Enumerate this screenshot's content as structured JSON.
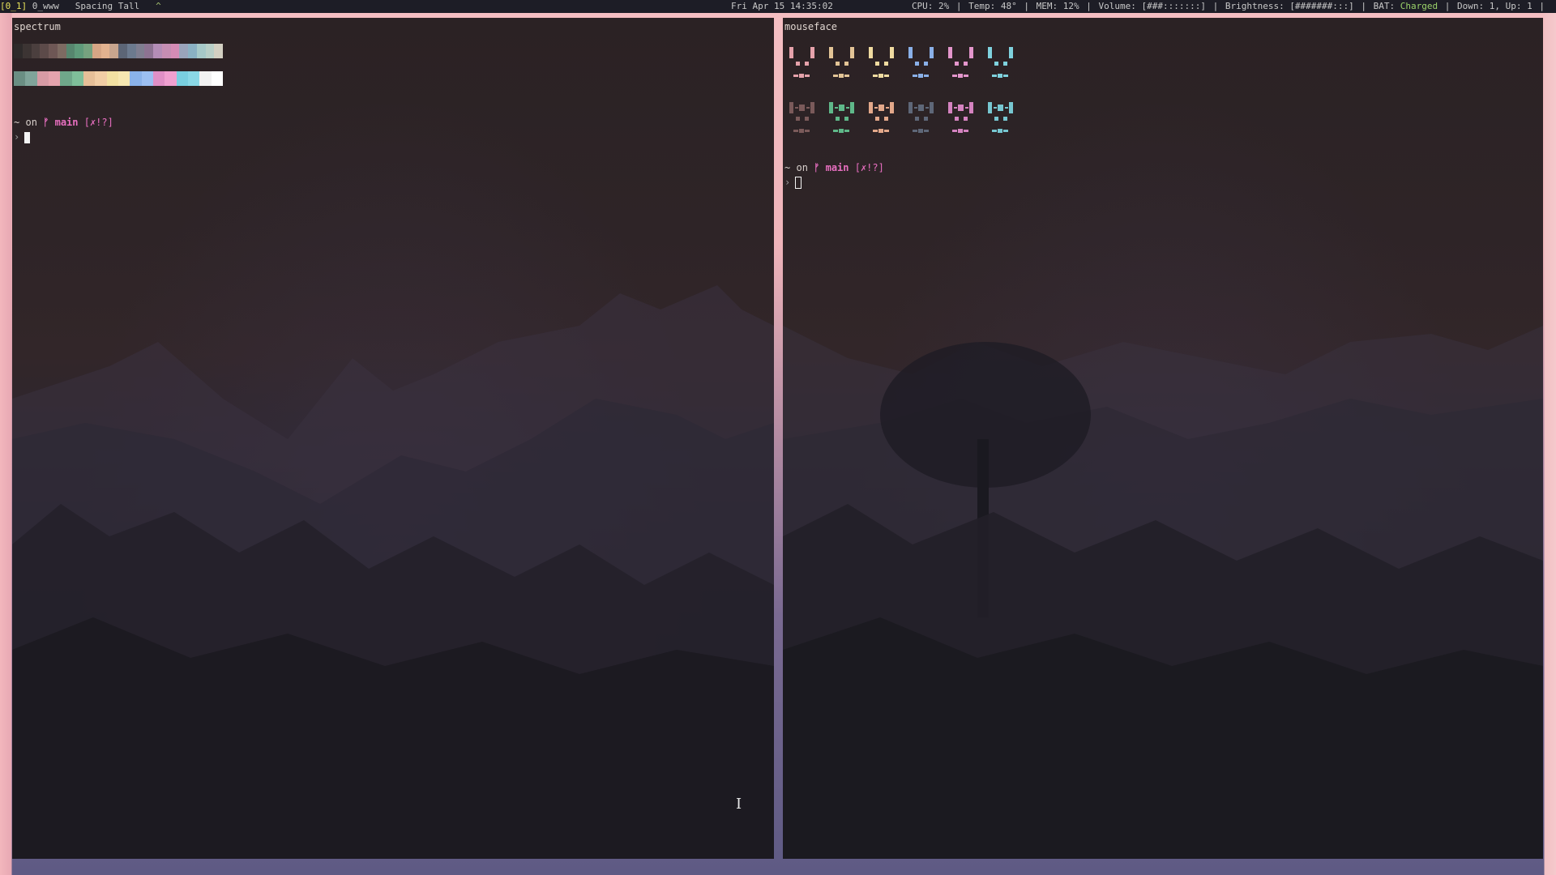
{
  "topbar": {
    "workspace_current": "[0_1]",
    "workspace_other": "0_www",
    "layout": "Spacing Tall",
    "tag": "^",
    "clock": "Fri Apr 15 14:35:02",
    "cpu": "CPU: 2%",
    "temp": "Temp: 48°",
    "mem": "MEM: 12%",
    "volume": "Volume: [###:::::::]",
    "brightness": "Brightness: [#######:::]",
    "bat_label": "BAT:",
    "bat_status": "Charged",
    "net": "Down: 1, Up: 1",
    "sep": "|"
  },
  "left_pane": {
    "title": "spectrum",
    "prompt_dir": "~",
    "prompt_on": "on",
    "git_symbol": "ᚠ",
    "branch": "main",
    "status": "[✗!?]",
    "prompt_arrow": "›",
    "spectrum_row1": [
      "#2e2a2a",
      "#3c3433",
      "#4b3f3e",
      "#5c4a49",
      "#6e5755",
      "#7d6b62",
      "#56866e",
      "#5f9a7a",
      "#76a27f",
      "#d6a685",
      "#e2b28f",
      "#c8a58e",
      "#5c6576",
      "#6c7a8e",
      "#7f7e90",
      "#8d7392",
      "#b48db6",
      "#c68eb3",
      "#d48cb5",
      "#9aa4bb",
      "#8ab1c3",
      "#a6c9c8",
      "#b8cfc7",
      "#d3d0c2"
    ],
    "spectrum_row2": [
      "#6a8e83",
      "#80a49a",
      "#d79ba5",
      "#e4a3ad",
      "#6fa78a",
      "#7fbf9a",
      "#e6bf98",
      "#f1cda5",
      "#f2e0a2",
      "#f6e7b1",
      "#8ab2ea",
      "#9cbff2",
      "#e08fc6",
      "#f0a0d0",
      "#79cfe0",
      "#8ad8e6",
      "#f2f2f2",
      "#ffffff"
    ]
  },
  "right_pane": {
    "title": "mouseface",
    "prompt_dir": "~",
    "prompt_on": "on",
    "git_symbol": "ᚠ",
    "branch": "main",
    "status": "[✗!?]",
    "prompt_arrow": "›",
    "faces_row1": [
      "#e6a2ab",
      "#e3c496",
      "#f0dba0",
      "#8ab0e8",
      "#e496cc",
      "#7fd2de"
    ],
    "faces_row2": [
      "#7a5a5a",
      "#5fb889",
      "#e3a88a",
      "#5e6778",
      "#d583c0",
      "#77c7d1"
    ]
  },
  "colors": {
    "accent_pink": "#e86fc0",
    "topbar_bg": "#1d1d26",
    "workspace_yellow": "#e7e25a",
    "charged_green": "#9bd36a"
  }
}
